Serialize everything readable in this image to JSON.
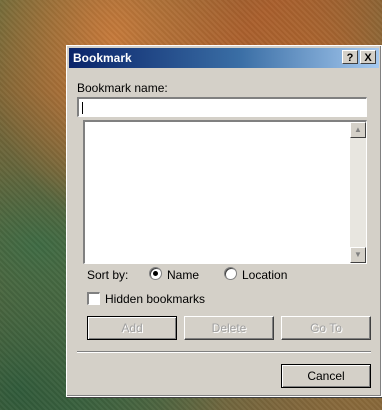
{
  "dialog": {
    "title": "Bookmark",
    "help_button": "?",
    "close_button": "X",
    "bookmark_name_label": "Bookmark name:",
    "bookmark_name_value": "",
    "bookmarks_list": [],
    "sort_by_label": "Sort by:",
    "sort_options": [
      {
        "label": "Name",
        "selected": true
      },
      {
        "label": "Location",
        "selected": false
      }
    ],
    "hidden_bookmarks_label": "Hidden bookmarks",
    "hidden_bookmarks_checked": false,
    "buttons": {
      "add": "Add",
      "delete": "Delete",
      "go_to": "Go To",
      "cancel": "Cancel"
    }
  }
}
